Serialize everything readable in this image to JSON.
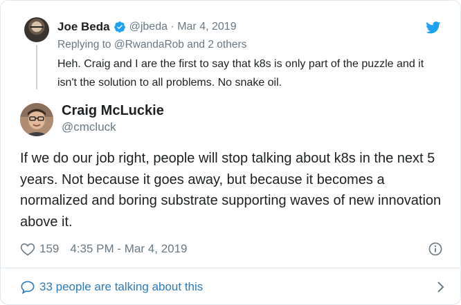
{
  "parent_tweet": {
    "author_name": "Joe Beda",
    "handle": "@jbeda",
    "separator": " · ",
    "date": "Mar 4, 2019",
    "replying_to": "Replying to @RwandaRob and 2 others",
    "text": "Heh. Craig and I are the first to say that k8s is only part of the puzzle and it isn't the solution to all problems. No snake oil."
  },
  "tweet": {
    "author_name": "Craig McLuckie",
    "handle": "@cmcluck",
    "text": "If we do our job right, people will stop talking about k8s in the next 5 years. Not because it goes away, but because it becomes a normalized and boring substrate supporting waves of new innovation above it.",
    "likes": "159",
    "timestamp": "4:35 PM - Mar 4, 2019"
  },
  "footer": {
    "talking_text": "33 people are talking about this"
  },
  "colors": {
    "text": "#1c2022",
    "muted": "#697882",
    "link": "#2b7bb9",
    "twitter_blue": "#1da1f2",
    "border": "#e1e8ed"
  },
  "icons": {
    "verified": "verified-badge-icon",
    "twitter": "twitter-bird-icon",
    "like": "heart-icon",
    "info": "info-icon",
    "reply": "speech-bubble-icon",
    "chevron": "chevron-right-icon"
  }
}
